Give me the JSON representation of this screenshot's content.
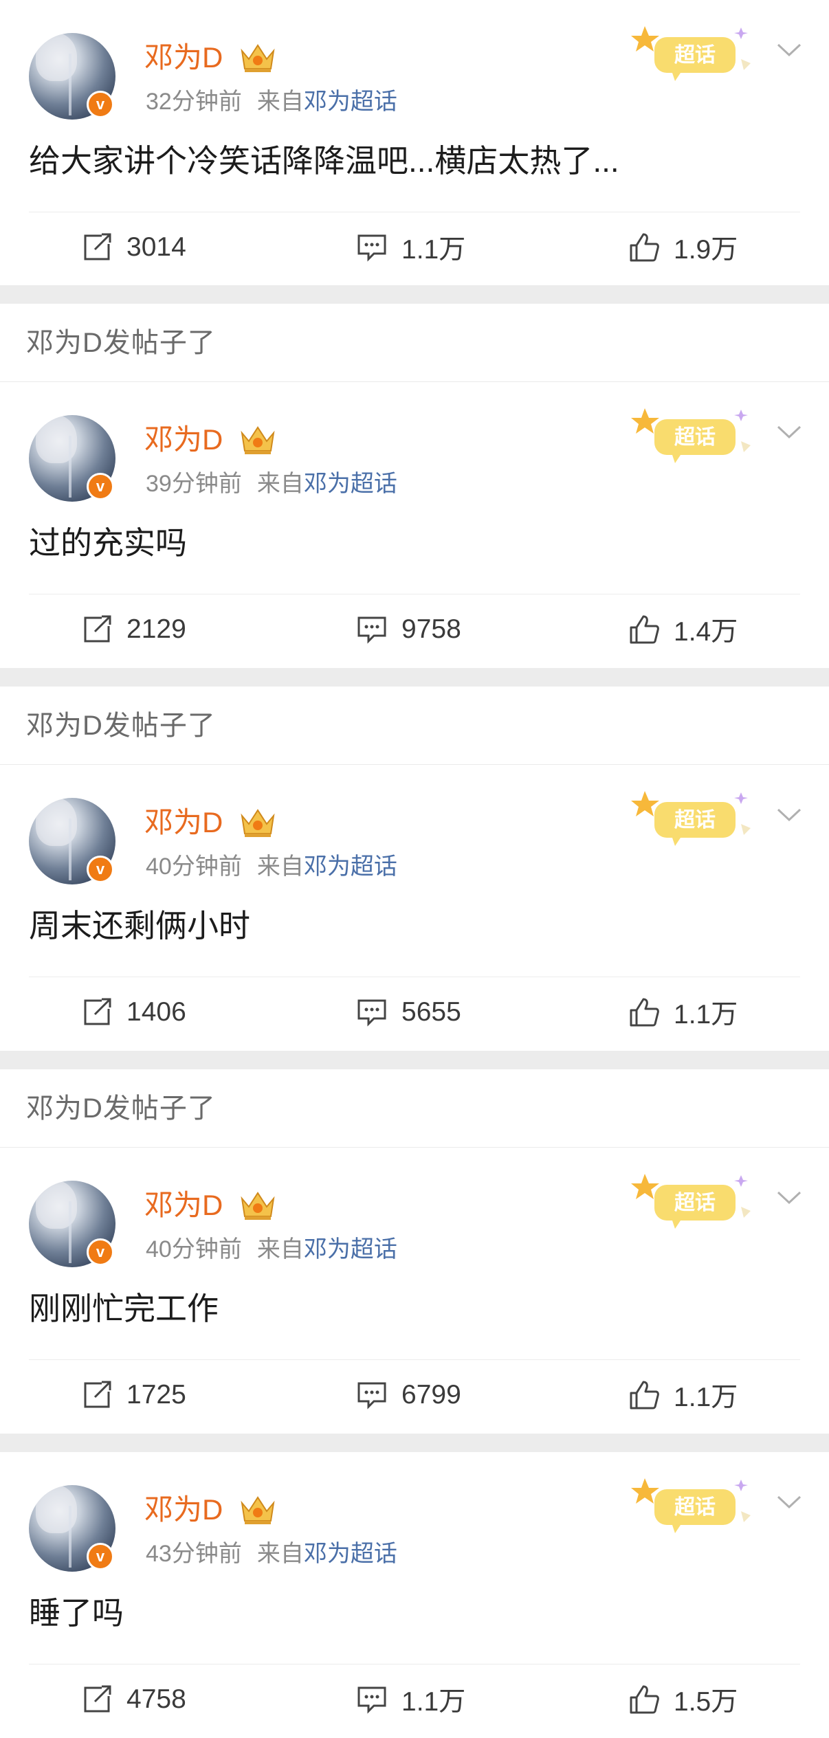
{
  "posts": [
    {
      "username": "邓为D",
      "time": "32分钟前",
      "from_label": "来自",
      "source": "邓为超话",
      "topic_badge": "超话",
      "content": "给大家讲个冷笑话降降温吧...横店太热了...",
      "reposts": "3014",
      "comments": "1.1万",
      "likes": "1.9万"
    },
    {
      "header": "邓为D发帖子了",
      "username": "邓为D",
      "time": "39分钟前",
      "from_label": "来自",
      "source": "邓为超话",
      "topic_badge": "超话",
      "content": "过的充实吗",
      "reposts": "2129",
      "comments": "9758",
      "likes": "1.4万"
    },
    {
      "header": "邓为D发帖子了",
      "username": "邓为D",
      "time": "40分钟前",
      "from_label": "来自",
      "source": "邓为超话",
      "topic_badge": "超话",
      "content": "周末还剩俩小时",
      "reposts": "1406",
      "comments": "5655",
      "likes": "1.1万"
    },
    {
      "header": "邓为D发帖子了",
      "username": "邓为D",
      "time": "40分钟前",
      "from_label": "来自",
      "source": "邓为超话",
      "topic_badge": "超话",
      "content": "刚刚忙完工作",
      "reposts": "1725",
      "comments": "6799",
      "likes": "1.1万"
    },
    {
      "username": "邓为D",
      "time": "43分钟前",
      "from_label": "来自",
      "source": "邓为超话",
      "topic_badge": "超话",
      "content": "睡了吗",
      "reposts": "4758",
      "comments": "1.1万",
      "likes": "1.5万"
    }
  ],
  "icons": {
    "verified": "v-badge",
    "crown": "crown-icon",
    "repost": "repost-icon",
    "comment": "comment-icon",
    "like": "like-icon",
    "more": "chevron-down-icon"
  },
  "colors": {
    "username": "#e86a1f",
    "source_link": "#4a6fa8",
    "verified_badge": "#f07b14",
    "topic_badge": "#f7d45c"
  }
}
